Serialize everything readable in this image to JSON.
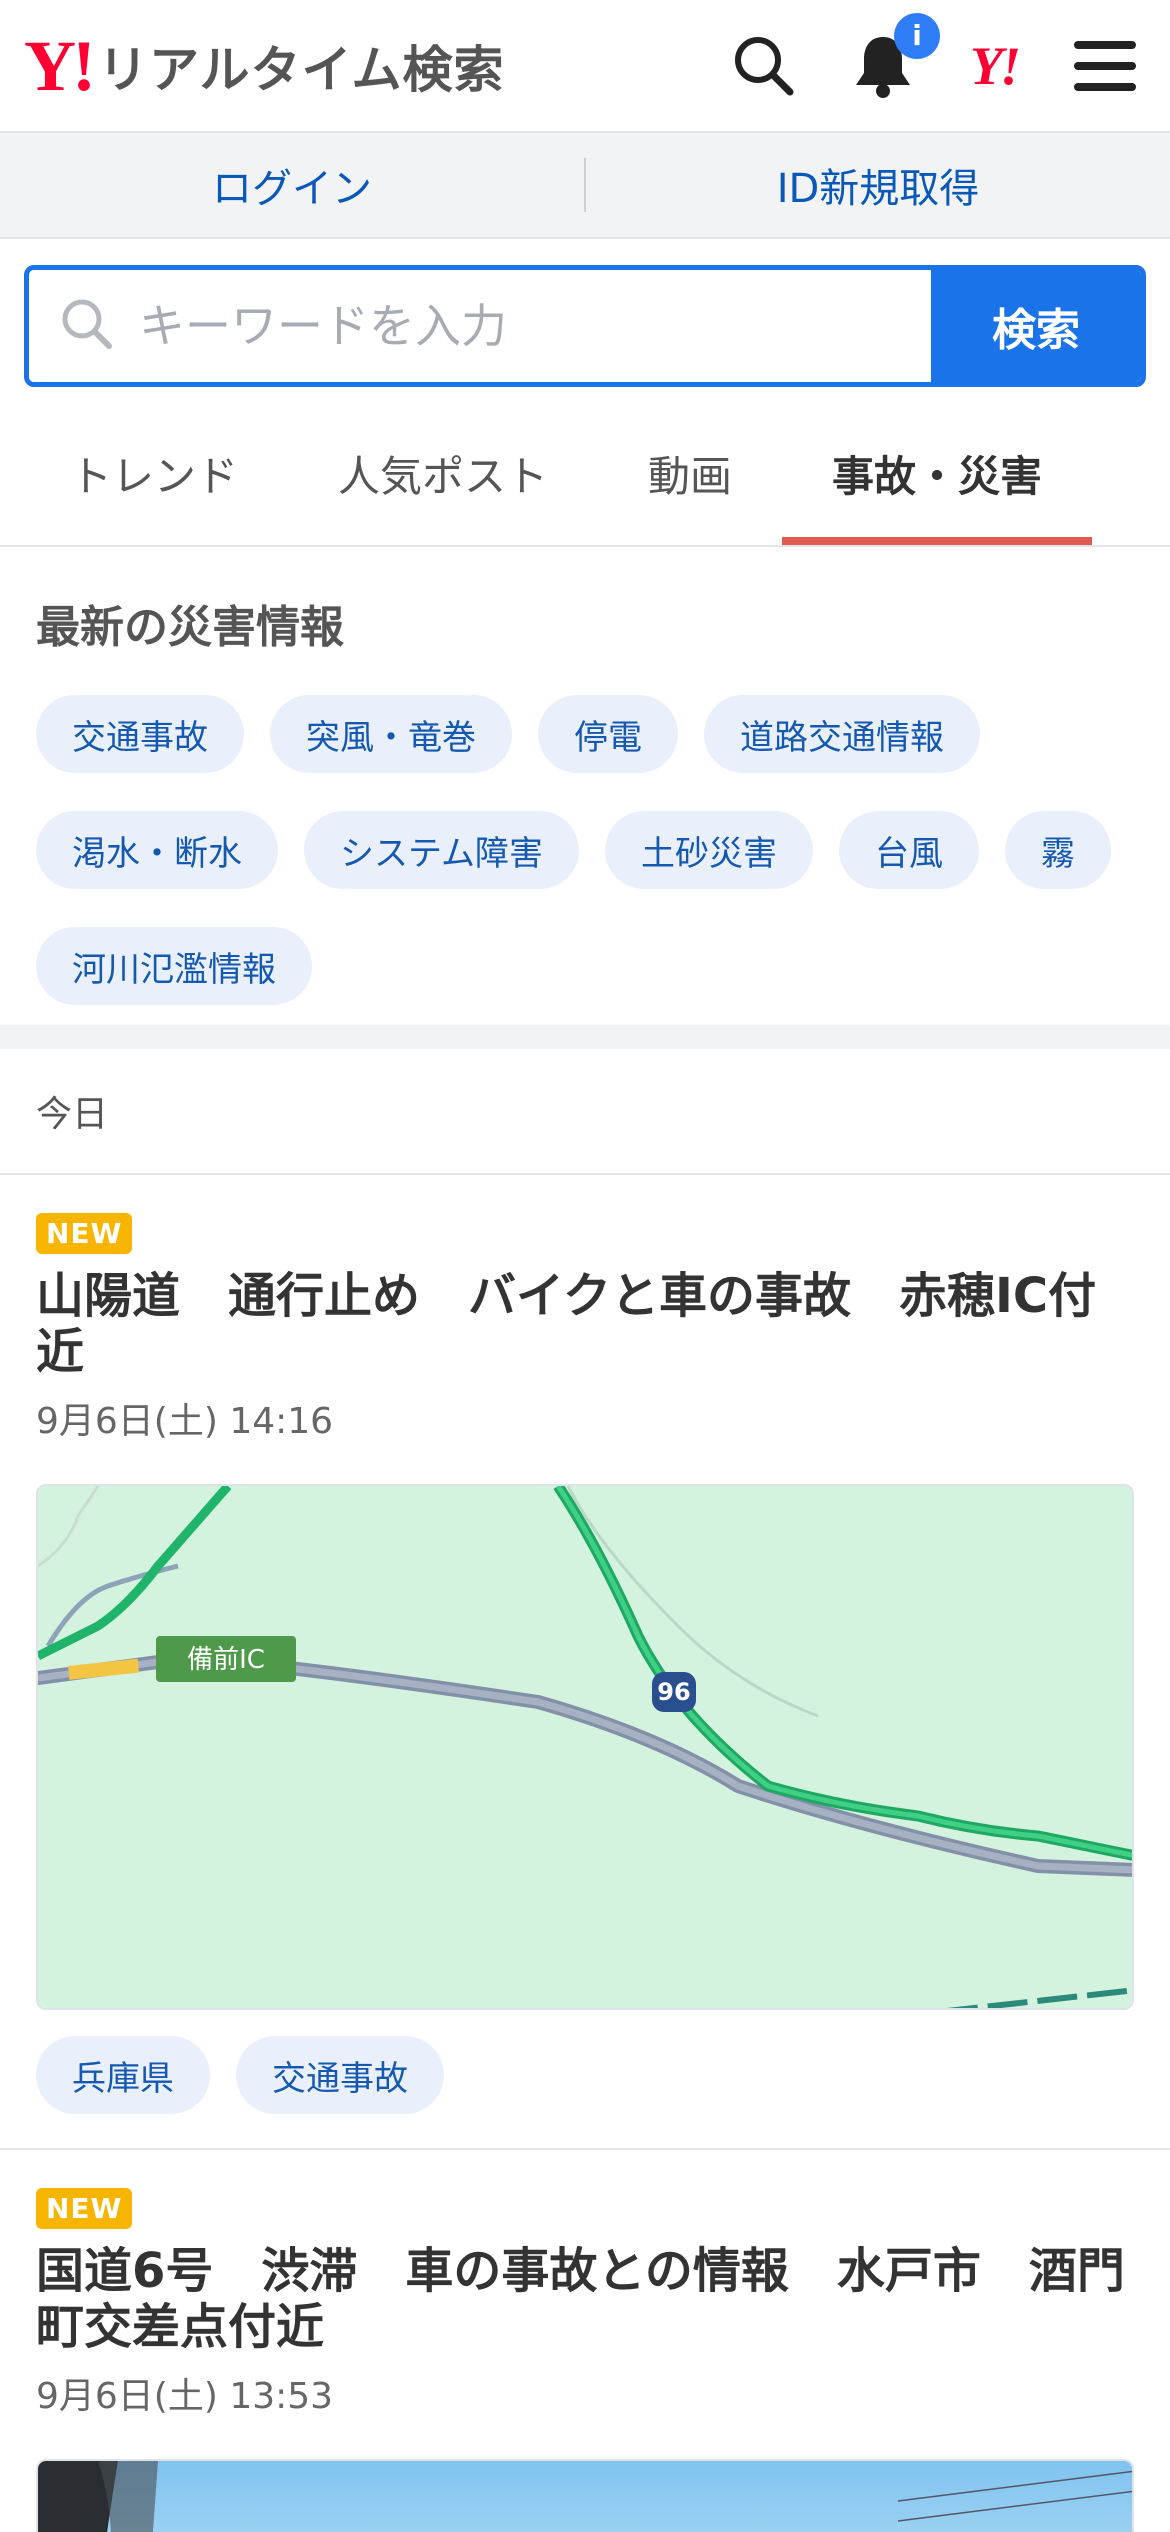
{
  "header": {
    "logo_mark": "Y!",
    "logo_text": "リアルタイム検索",
    "notification_badge": "i",
    "yahoo_mark": "Y!"
  },
  "account": {
    "login_label": "ログイン",
    "signup_label": "ID新規取得"
  },
  "search": {
    "placeholder": "キーワードを入力",
    "button_label": "検索"
  },
  "tabs": [
    {
      "label": "トレンド"
    },
    {
      "label": "人気ポスト"
    },
    {
      "label": "動画"
    },
    {
      "label": "事故・災害",
      "active": true
    }
  ],
  "disaster": {
    "title": "最新の災害情報",
    "chips": [
      "交通事故",
      "突風・竜巻",
      "停電",
      "道路交通情報",
      "渇水・断水",
      "システム障害",
      "土砂災害",
      "台風",
      "霧",
      "河川氾濫情報"
    ]
  },
  "today_label": "今日",
  "articles": [
    {
      "badge": "NEW",
      "title": "山陽道　通行止め　バイクと車の事故　赤穂IC付近",
      "date": "9月6日(土) 14:16",
      "map_label": "備前IC",
      "route_number": "96",
      "tags": [
        "兵庫県",
        "交通事故"
      ]
    },
    {
      "badge": "NEW",
      "title": "国道6号　渋滞　車の事故との情報　水戸市　酒門町交差点付近",
      "date": "9月6日(土) 13:53"
    }
  ],
  "colors": {
    "brand_red": "#ff0033",
    "accent_blue": "#1a73e8",
    "tab_underline": "#e05a4f",
    "chip_bg": "#e9f0fb",
    "new_badge": "#f8b500"
  }
}
